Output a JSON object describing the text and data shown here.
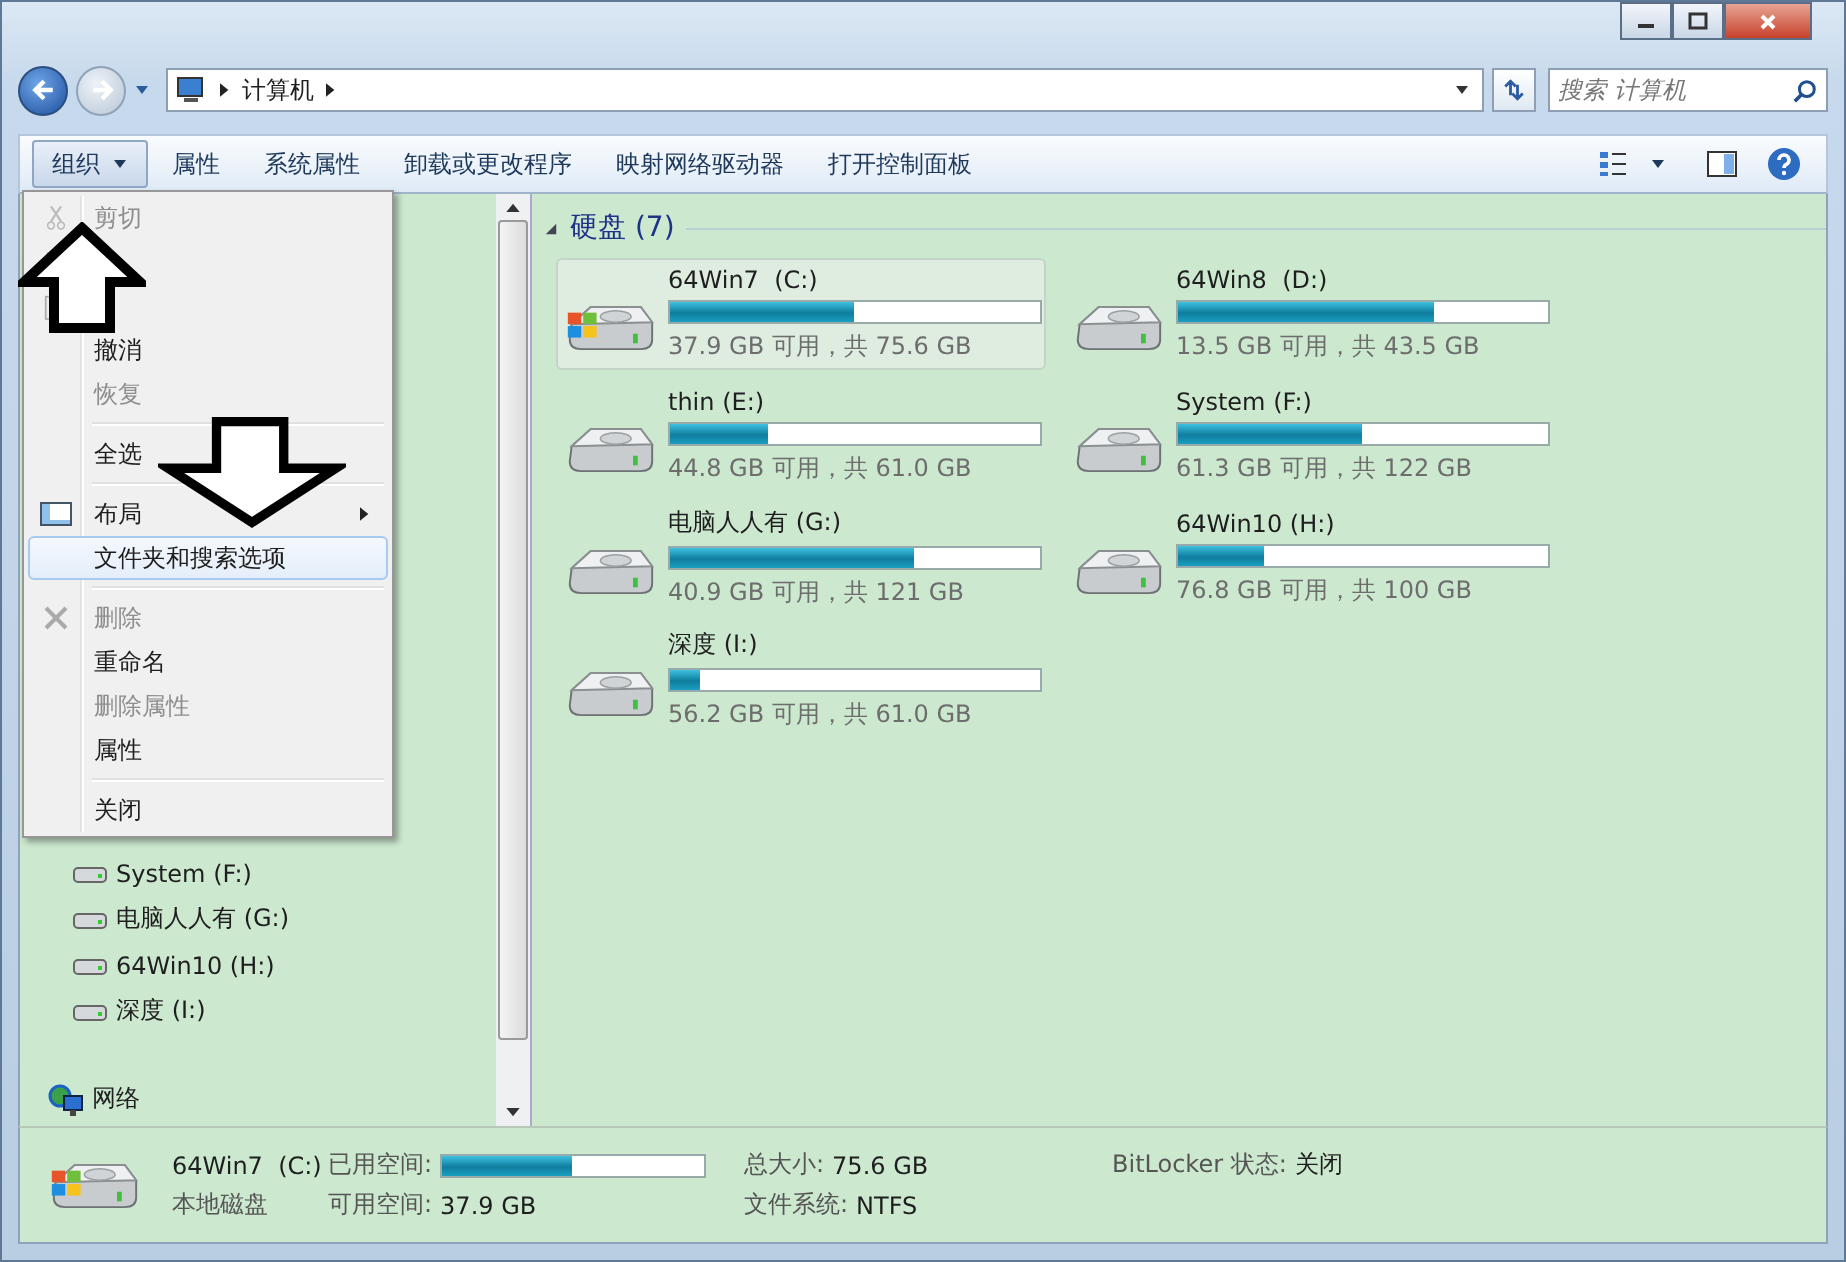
{
  "address": {
    "path": [
      "计算机"
    ]
  },
  "search": {
    "placeholder": "搜索 计算机"
  },
  "toolbar": {
    "buttons": [
      {
        "label": "组织",
        "dropdown": true,
        "selected": true
      },
      {
        "label": "属性",
        "dropdown": false,
        "selected": false
      },
      {
        "label": "系统属性",
        "dropdown": false,
        "selected": false
      },
      {
        "label": "卸载或更改程序",
        "dropdown": false,
        "selected": false
      },
      {
        "label": "映射网络驱动器",
        "dropdown": false,
        "selected": false
      },
      {
        "label": "打开控制面板",
        "dropdown": false,
        "selected": false
      }
    ]
  },
  "menu": {
    "items": [
      {
        "kind": "cut",
        "label": "剪切",
        "disabled": true,
        "selected": false
      },
      {
        "kind": "copy"
      },
      {
        "kind": "paste"
      },
      {
        "kind": "plain",
        "label": "撤消",
        "disabled": false,
        "selected": false
      },
      {
        "kind": "plain",
        "label": "恢复",
        "disabled": true,
        "selected": false
      },
      {
        "kind": "separator"
      },
      {
        "kind": "plain",
        "label": "全选",
        "disabled": false,
        "selected": false
      },
      {
        "kind": "separator"
      },
      {
        "kind": "layout",
        "label": "布局",
        "disabled": false,
        "submenu": true,
        "selected": false
      },
      {
        "kind": "plain",
        "label": "文件夹和搜索选项",
        "disabled": false,
        "selected": true
      },
      {
        "kind": "separator"
      },
      {
        "kind": "delete",
        "label": "删除",
        "disabled": true,
        "selected": false
      },
      {
        "kind": "plain",
        "label": "重命名",
        "disabled": false,
        "selected": false
      },
      {
        "kind": "plain",
        "label": "删除属性",
        "disabled": true,
        "selected": false
      },
      {
        "kind": "plain",
        "label": "属性",
        "disabled": false,
        "selected": false
      },
      {
        "kind": "separator"
      },
      {
        "kind": "plain",
        "label": "关闭",
        "disabled": false,
        "selected": false
      }
    ]
  },
  "sidebar": {
    "items": [
      {
        "kind": "drive",
        "label": "System (F:)"
      },
      {
        "kind": "drive",
        "label": "电脑人人有 (G:)"
      },
      {
        "kind": "drive",
        "label": "64Win10 (H:)"
      },
      {
        "kind": "drive",
        "label": "深度 (I:)"
      },
      {
        "kind": "network",
        "label": "网络"
      }
    ]
  },
  "section": {
    "title": "硬盘 (7)",
    "expanded": true
  },
  "drives": [
    {
      "name": "64Win7  (C:)",
      "space": "37.9 GB 可用，共 75.6 GB",
      "level": 0.499,
      "system": true,
      "selected": true
    },
    {
      "name": "64Win8  (D:)",
      "space": "13.5 GB 可用，共 43.5 GB",
      "level": 0.69,
      "system": false,
      "selected": false
    },
    {
      "name": "thin (E:)",
      "space": "44.8 GB 可用，共 61.0 GB",
      "level": 0.266,
      "system": false,
      "selected": false
    },
    {
      "name": "System (F:)",
      "space": "61.3 GB 可用，共 122 GB",
      "level": 0.497,
      "system": false,
      "selected": false
    },
    {
      "name": "电脑人人有 (G:)",
      "space": "40.9 GB 可用，共 121 GB",
      "level": 0.662,
      "system": false,
      "selected": false
    },
    {
      "name": "64Win10 (H:)",
      "space": "76.8 GB 可用，共 100 GB",
      "level": 0.232,
      "system": false,
      "selected": false
    },
    {
      "name": "深度 (I:)",
      "space": "56.2 GB 可用，共 61.0 GB",
      "level": 0.079,
      "system": false,
      "selected": false
    }
  ],
  "details": {
    "name": "64Win7  (C:)",
    "type": "本地磁盘",
    "system": true,
    "used_label": "已用空间:",
    "level": 0.499,
    "free_label": "可用空间:",
    "free": "37.9 GB",
    "total_label": "总大小:",
    "total": "75.6 GB",
    "fs_label": "文件系统:",
    "fs": "NTFS",
    "bitlocker_label": "BitLocker 状态:",
    "bitlocker": "关闭"
  }
}
